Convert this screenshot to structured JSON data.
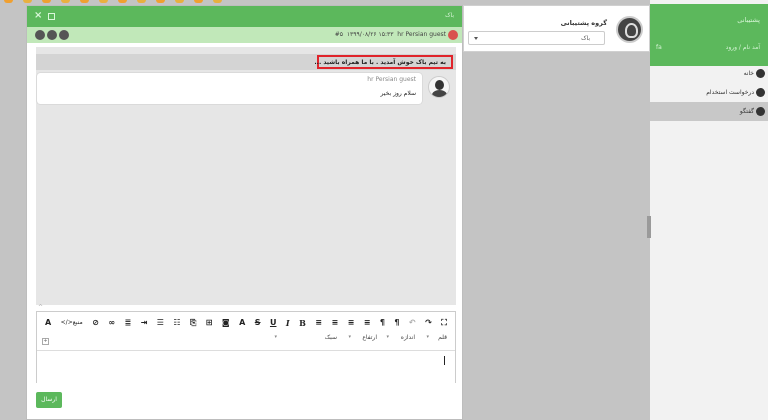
{
  "colors": {
    "accent_green": "#5cb85c",
    "light_green": "#c1e8b9",
    "highlight_red": "#e0242b",
    "top_tabs": [
      "#f0a030",
      "#e8b040",
      "#f0a030",
      "#e8b040",
      "#f0a030",
      "#e8b040",
      "#f0a030",
      "#e8b040",
      "#f0a030",
      "#e8b040",
      "#f0a030",
      "#e8b040"
    ]
  },
  "sidebar": {
    "header_title": "پشتیبانی",
    "header_subtitle": "آمد نام / ورود",
    "header_badge": "fa",
    "items": [
      {
        "label": "خانه",
        "icon": "home-icon"
      },
      {
        "label": "درخواست استخدام",
        "icon": "user-icon"
      },
      {
        "label": "گفتگو",
        "icon": "chat-icon"
      }
    ]
  },
  "support_group": {
    "title": "گروه پشتیبانی",
    "selected": "باک"
  },
  "chat": {
    "title": "باک",
    "info": {
      "user": "hr Persian guest",
      "datetime": "۱۳۹۹/۰۸/۲۶ ۱۵:۳۳",
      "ticket": "#۵"
    },
    "welcome": "به تیم باک خوش آمدید . با ما همراه باشید ...",
    "message": {
      "sender": "hr Persian guest",
      "text": "سلام روز بخیر"
    },
    "editor": {
      "source_label": "منبع",
      "font_label": "قلم",
      "size_label": "اندازه",
      "height_label": "ارتفاع",
      "style_label": "سبک"
    },
    "send_label": "ارسال"
  }
}
